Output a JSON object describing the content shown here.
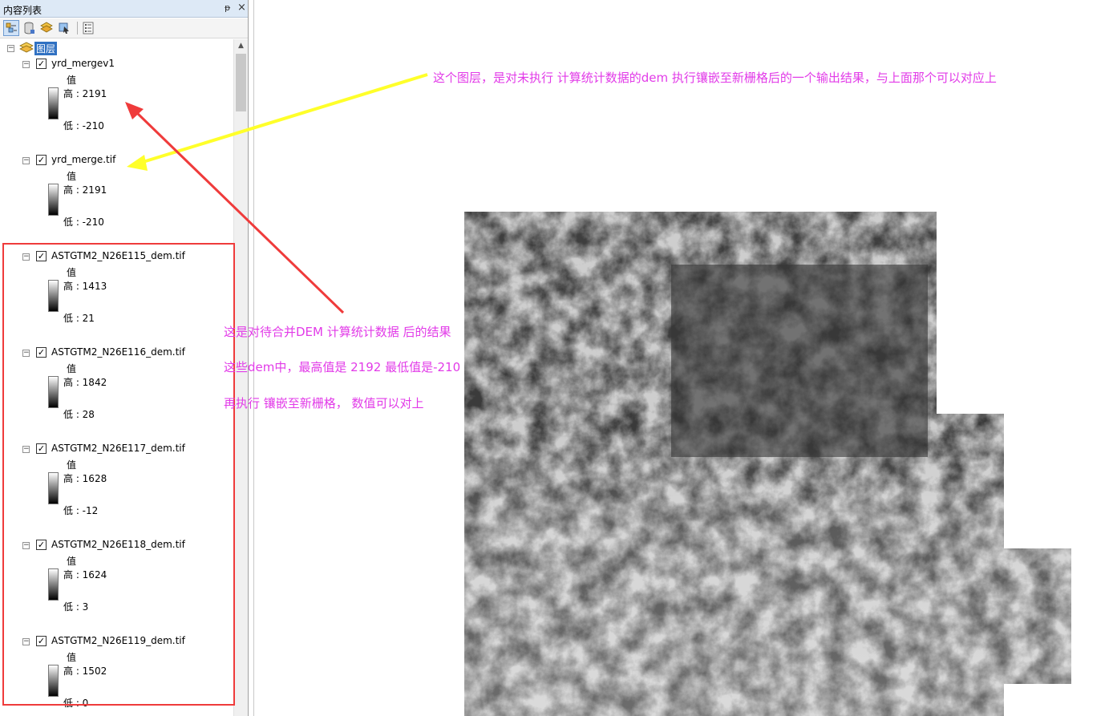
{
  "panel": {
    "title": "内容列表",
    "pin_glyph": "ᵽ",
    "close_glyph": "×"
  },
  "toolbar": {
    "buttons": [
      {
        "name": "list-by-drawing-order",
        "icon": "drawing-order-icon"
      },
      {
        "name": "list-by-source",
        "icon": "database-icon"
      },
      {
        "name": "list-by-visibility",
        "icon": "layers-icon"
      },
      {
        "name": "list-by-selection",
        "icon": "selection-icon"
      },
      {
        "name": "options",
        "icon": "list-options-icon"
      }
    ]
  },
  "tree": {
    "root_label": "图层",
    "layers": [
      {
        "name": "yrd_mergev1",
        "value_label": "值",
        "high": "高 : 2191",
        "low": "低 : -210"
      },
      {
        "name": "yrd_merge.tif",
        "value_label": "值",
        "high": "高 : 2191",
        "low": "低 : -210"
      },
      {
        "name": "ASTGTM2_N26E115_dem.tif",
        "value_label": "值",
        "high": "高 : 1413",
        "low": "低 : 21"
      },
      {
        "name": "ASTGTM2_N26E116_dem.tif",
        "value_label": "值",
        "high": "高 : 1842",
        "low": "低 : 28"
      },
      {
        "name": "ASTGTM2_N26E117_dem.tif",
        "value_label": "值",
        "high": "高 : 1628",
        "low": "低 : -12"
      },
      {
        "name": "ASTGTM2_N26E118_dem.tif",
        "value_label": "值",
        "high": "高 : 1624",
        "low": "低 : 3"
      },
      {
        "name": "ASTGTM2_N26E119_dem.tif",
        "value_label": "值",
        "high": "高 : 1502",
        "low": "低 : 0"
      }
    ]
  },
  "annotations": {
    "top_note": "这个图层，是对未执行 计算统计数据的dem 执行镶嵌至新栅格后的一个输出结果，与上面那个可以对应上",
    "note_1": "这是对待合并DEM 计算统计数据 后的结果",
    "note_2": "这些dem中，最高值是 2192 最低值是-210",
    "note_3": "再执行 镶嵌至新栅格， 数值可以对上",
    "red_color": "#ef3b3b",
    "yellow_color": "#ffff2a",
    "text_color": "#e23be8"
  }
}
